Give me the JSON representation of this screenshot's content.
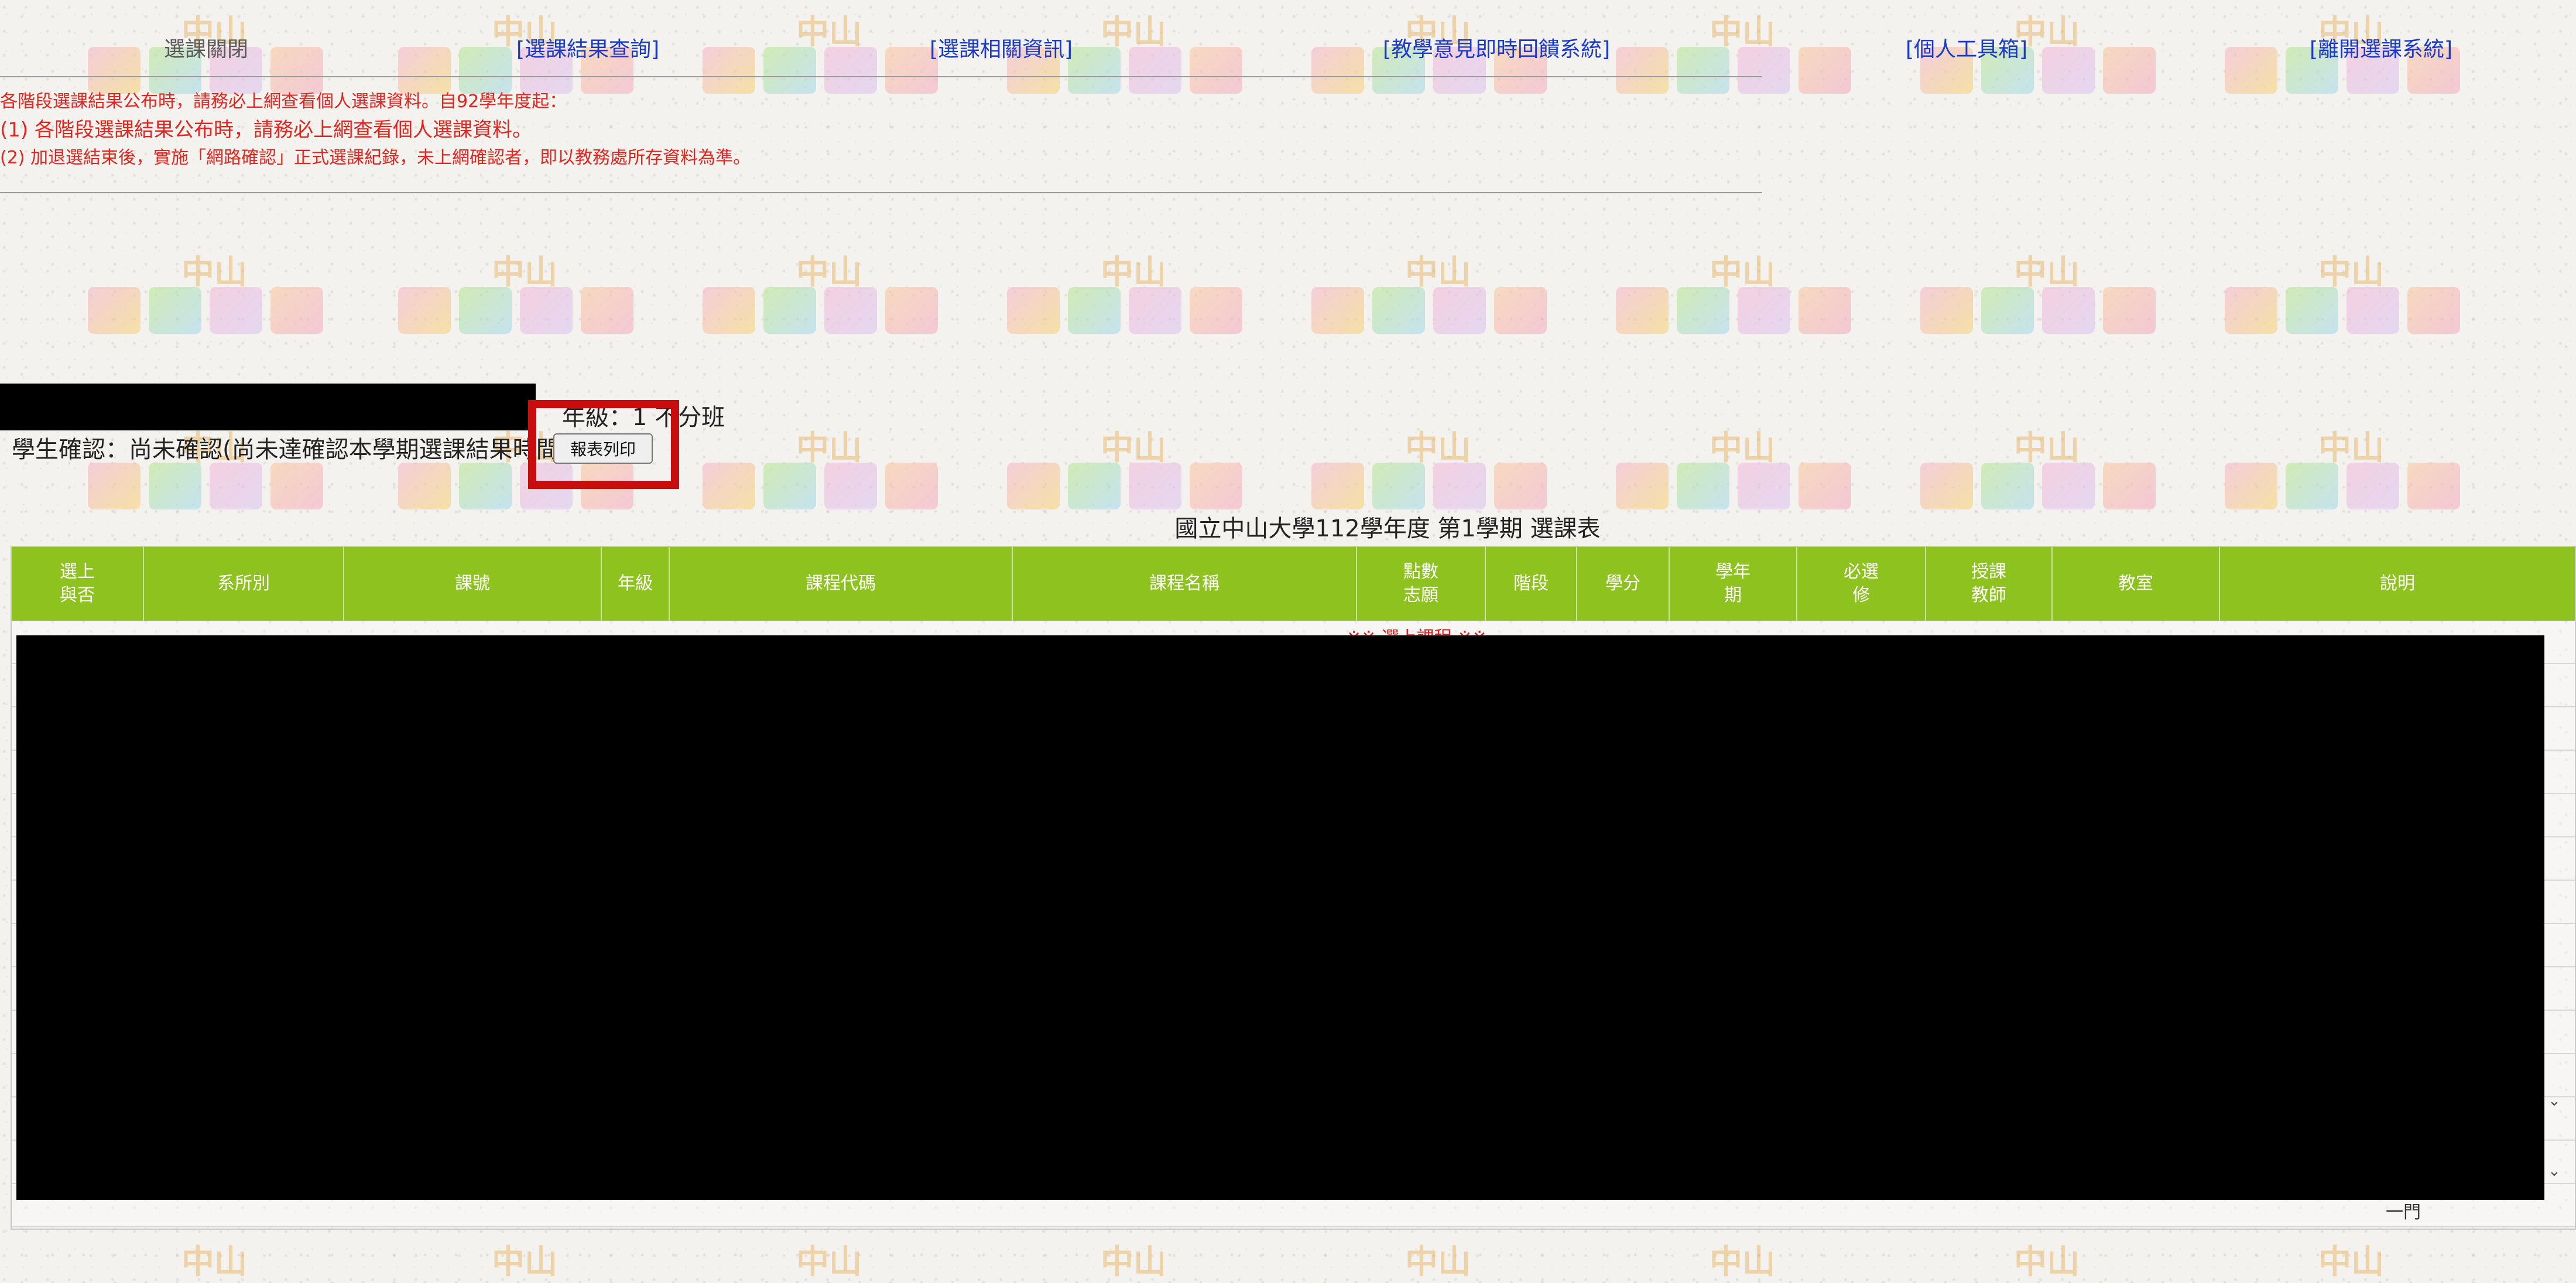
{
  "nav": {
    "items": [
      {
        "label": "選課關閉",
        "enabled": false
      },
      {
        "label": "[選課結果查詢]",
        "enabled": true
      },
      {
        "label": "[選課相關資訊]",
        "enabled": true
      },
      {
        "label": "[教學意見即時回饋系統]",
        "enabled": true
      },
      {
        "label": "[個人工具箱]",
        "enabled": true
      },
      {
        "label": "[離開選課系統]",
        "enabled": true
      }
    ]
  },
  "notice": {
    "line1": "各階段選課結果公布時，請務必上網查看個人選課資料。自92學年度起：",
    "line2": "(1) 各階段選課結果公布時，請務必上網查看個人選課資料。",
    "line3": "(2) 加退選結束後，實施「網路確認」正式選課紀錄，未上網確認者，即以教務處所存資料為準。"
  },
  "student": {
    "class_text": "年級：1  不分班",
    "confirm_text": "學生確認：尚未確認(尚未達確認本學期選課結果時間)",
    "print_button": "報表列印"
  },
  "table": {
    "title": "國立中山大學112學年度 第1學期 選課表",
    "headers": [
      "選上\n與否",
      "系所別",
      "課號",
      "年級",
      "課程代碼",
      "課程名稱",
      "點數\n志願",
      "階段",
      "學分",
      "學年\n期",
      "必選\n修",
      "授課\n教師",
      "教室",
      "說明"
    ],
    "section_label": "※※ 選上課程 ※※",
    "total_text": "一門"
  },
  "colors": {
    "header_bg": "#8dc21f",
    "link": "#1a3ac9",
    "notice": "#e0261f",
    "highlight": "#c90d0d"
  }
}
